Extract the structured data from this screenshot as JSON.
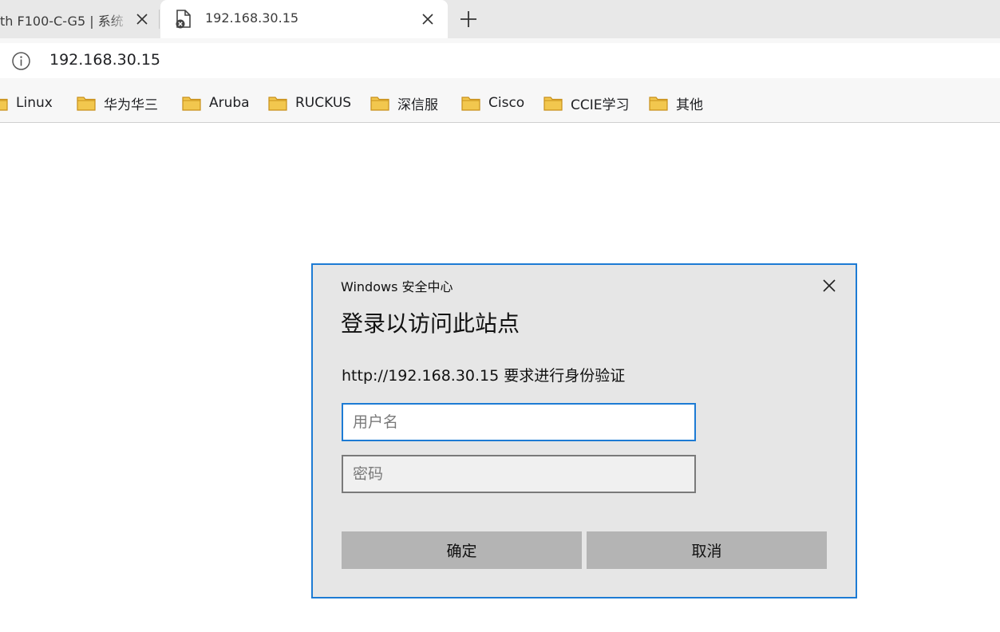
{
  "browser": {
    "tabs": [
      {
        "title": "th F100-C-G5 | 系统",
        "active": false
      },
      {
        "title": "192.168.30.15",
        "active": true
      }
    ],
    "address_bar": {
      "url": "192.168.30.15"
    },
    "bookmarks": [
      {
        "label": "Linux"
      },
      {
        "label": "华为华三"
      },
      {
        "label": "Aruba"
      },
      {
        "label": "RUCKUS"
      },
      {
        "label": "深信服"
      },
      {
        "label": "Cisco"
      },
      {
        "label": "CCIE学习"
      },
      {
        "label": "其他"
      }
    ]
  },
  "dialog": {
    "app_name": "Windows 安全中心",
    "title": "登录以访问此站点",
    "message": "http://192.168.30.15 要求进行身份验证",
    "username": {
      "value": "",
      "placeholder": "用户名"
    },
    "password": {
      "value": "",
      "placeholder": "密码"
    },
    "ok_label": "确定",
    "cancel_label": "取消"
  },
  "colors": {
    "accent": "#1d7bd4",
    "folder": "#f2c74e",
    "dialog_bg": "#e6e6e6",
    "button_bg": "#b4b4b4"
  },
  "icons": {
    "tab_favicon": "page-error-icon",
    "address_info": "info-icon",
    "bookmark_folder": "folder-icon"
  }
}
